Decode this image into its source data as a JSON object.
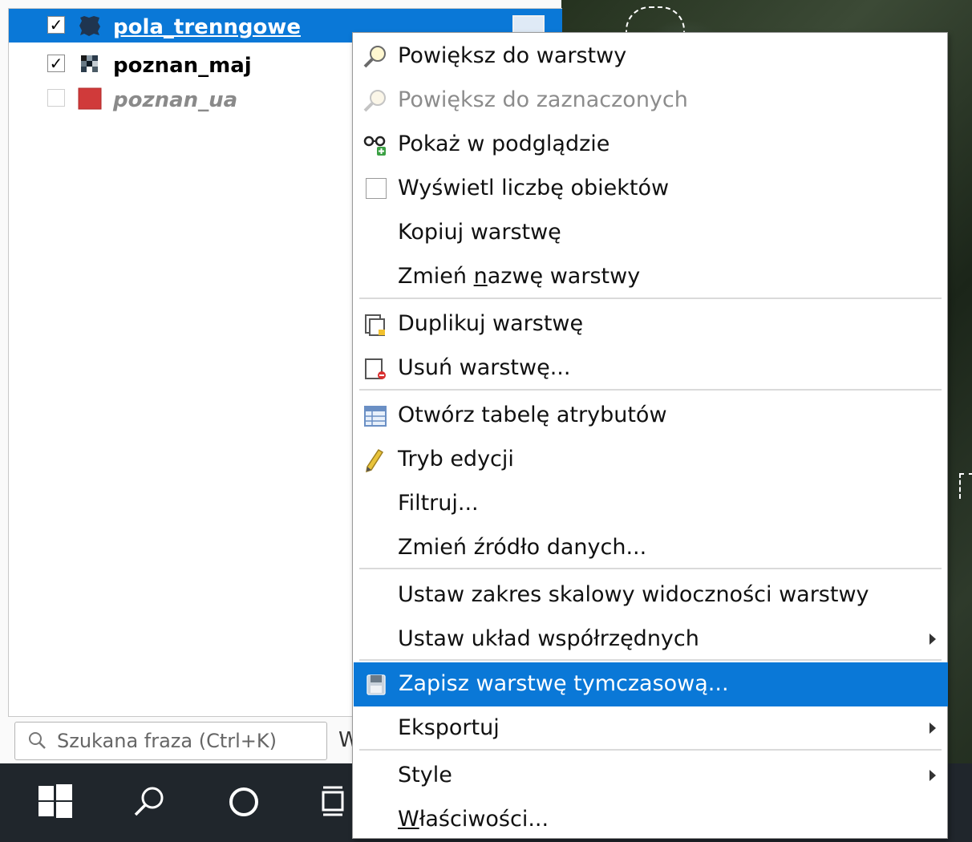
{
  "layers": [
    {
      "name": "pola_trenngowe",
      "checked": true,
      "selected": true,
      "symbol": "polygon-dark-icon",
      "symbol_color": "#1f3550"
    },
    {
      "name": "poznan_maj",
      "checked": true,
      "selected": false,
      "symbol": "raster-icon"
    },
    {
      "name": "poznan_ua",
      "checked": false,
      "selected": false,
      "symbol": "polygon-red-icon",
      "symbol_color": "#d03a3a"
    }
  ],
  "search": {
    "placeholder": "Szukana fraza (Ctrl+K)",
    "trailing_text": "W"
  },
  "menu": {
    "zoom_to_layer": "Powiększ do warstwy",
    "zoom_to_selected": "Powiększ do zaznaczonych",
    "show_in_overview": "Pokaż w podglądzie",
    "show_feature_count": "Wyświetl liczbę obiektów",
    "copy_layer": "Kopiuj warstwę",
    "rename_pre": "Zmień ",
    "rename_mnemonic": "n",
    "rename_post": "azwę warstwy",
    "duplicate_layer": "Duplikuj warstwę",
    "remove_layer": "Usuń warstwę...",
    "open_attribute_table": "Otwórz tabelę atrybutów",
    "toggle_editing": "Tryb edycji",
    "filter": "Filtruj...",
    "change_data_source": "Zmień źródło danych...",
    "set_scale_visibility": "Ustaw zakres skalowy widoczności warstwy",
    "set_crs": "Ustaw układ współrzędnych",
    "save_temp_layer": "Zapisz warstwę tymczasową...",
    "export": "Eksportuj",
    "styles": "Style",
    "properties_mnemonic": "W",
    "properties_post": "łaściwości..."
  },
  "colors": {
    "accent": "#0a78d7",
    "taskbar": "#20262c"
  }
}
